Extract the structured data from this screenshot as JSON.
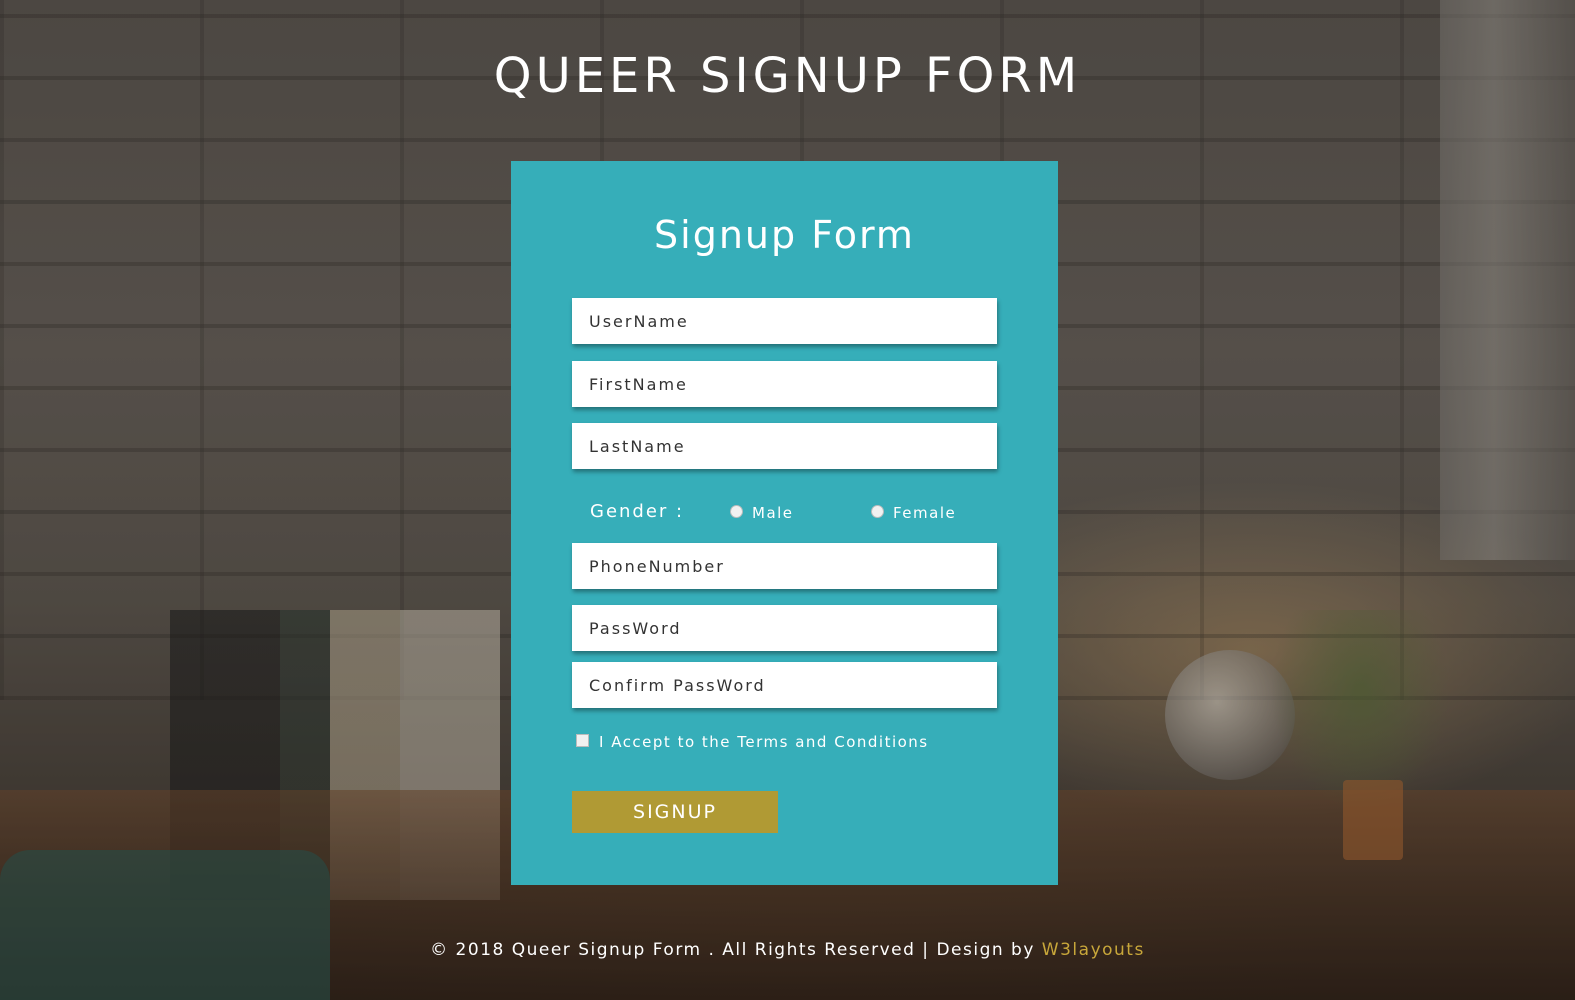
{
  "page": {
    "title": "QUEER SIGNUP FORM"
  },
  "form": {
    "heading": "Signup Form",
    "username_placeholder": "UserName",
    "firstname_placeholder": "FirstName",
    "lastname_placeholder": "LastName",
    "gender": {
      "label": "Gender :",
      "options": [
        "Male",
        "Female"
      ]
    },
    "phone_placeholder": "PhoneNumber",
    "password_placeholder": "PassWord",
    "confirm_placeholder": "Confirm PassWord",
    "terms_label": "I Accept to the Terms and Conditions",
    "submit_label": "SIGNUP"
  },
  "footer": {
    "text": "© 2018 Queer Signup Form . All Rights Reserved | Design by ",
    "link_text": "W3layouts"
  },
  "colors": {
    "card": "#36aeb9",
    "button": "#b09a34",
    "link": "#c8a73a"
  }
}
